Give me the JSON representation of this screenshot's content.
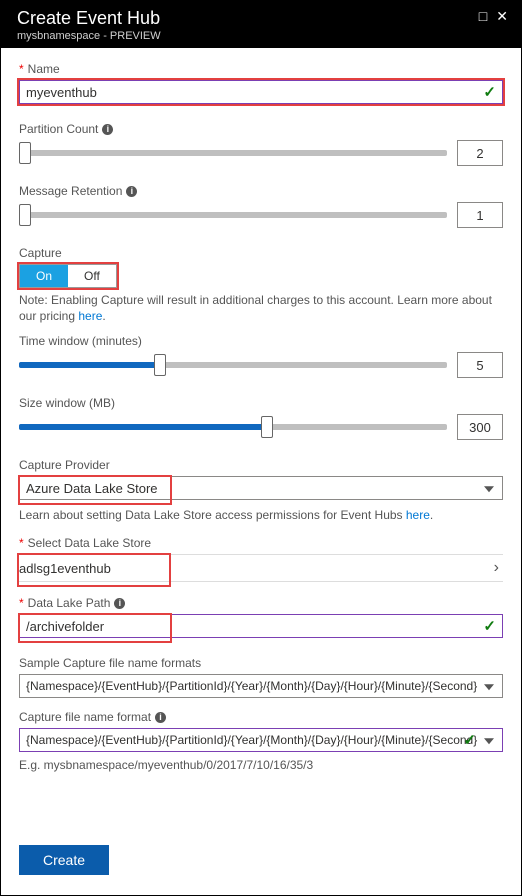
{
  "header": {
    "title": "Create Event Hub",
    "subtitle": "mysbnamespace - PREVIEW"
  },
  "name": {
    "label": "Name",
    "value": "myeventhub"
  },
  "partition": {
    "label": "Partition Count",
    "value": "2"
  },
  "retention": {
    "label": "Message Retention",
    "value": "1"
  },
  "capture": {
    "label": "Capture",
    "on": "On",
    "off": "Off",
    "note_prefix": "Note: Enabling Capture will result in additional charges to this account. Learn more about our pricing ",
    "note_link": "here"
  },
  "time_window": {
    "label": "Time window (minutes)",
    "value": "5",
    "fill_pct": 33
  },
  "size_window": {
    "label": "Size window (MB)",
    "value": "300",
    "fill_pct": 58
  },
  "provider": {
    "label": "Capture Provider",
    "value": "Azure Data Lake Store"
  },
  "learn_line_prefix": "Learn about setting Data Lake Store access permissions for Event Hubs ",
  "learn_line_link": "here",
  "datastore": {
    "label": "Select Data Lake Store",
    "value": "adlsg1eventhub"
  },
  "datapath": {
    "label": "Data Lake Path",
    "value": "/archivefolder"
  },
  "sample_formats": {
    "label": "Sample Capture file name formats",
    "value": "{Namespace}/{EventHub}/{PartitionId}/{Year}/{Month}/{Day}/{Hour}/{Minute}/{Second}"
  },
  "capture_format": {
    "label": "Capture file name format",
    "value": "{Namespace}/{EventHub}/{PartitionId}/{Year}/{Month}/{Day}/{Hour}/{Minute}/{Second}"
  },
  "example": "E.g. mysbnamespace/myeventhub/0/2017/7/10/16/35/3",
  "footer": {
    "create": "Create"
  }
}
